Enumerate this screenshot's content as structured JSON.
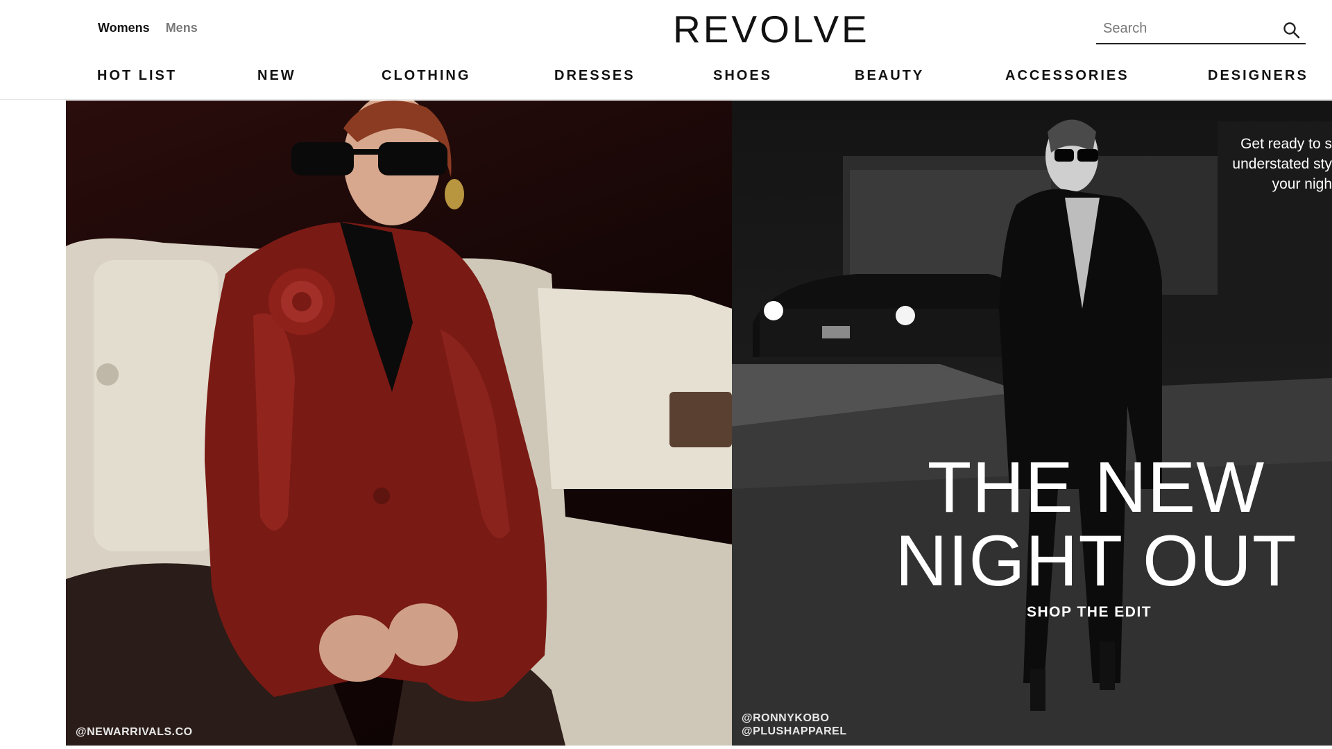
{
  "header": {
    "gender_tabs": [
      {
        "label": "Womens",
        "active": true
      },
      {
        "label": "Mens",
        "active": false
      }
    ],
    "logo": "REVOLVE",
    "search": {
      "placeholder": "Search",
      "value": "",
      "icon": "search-icon"
    }
  },
  "nav": {
    "items": [
      "HOT LIST",
      "NEW",
      "CLOTHING",
      "DRESSES",
      "SHOES",
      "BEAUTY",
      "ACCESSORIES",
      "DESIGNERS"
    ]
  },
  "hero": {
    "left_credit": "@NEWARRIVALS.CO",
    "right_credit_lines": [
      "@RONNYKOBO",
      "@PLUSHAPPAREL"
    ],
    "subtext_lines": [
      "Get ready to s",
      "understated sty",
      "your nigh"
    ],
    "headline_lines": [
      "THE NEW",
      "NIGHT OUT"
    ],
    "cta": "SHOP THE EDIT"
  },
  "colors": {
    "text_primary": "#111111",
    "text_muted": "#7a7a7a",
    "background": "#ffffff",
    "jacket_red": "#7a1a14"
  }
}
